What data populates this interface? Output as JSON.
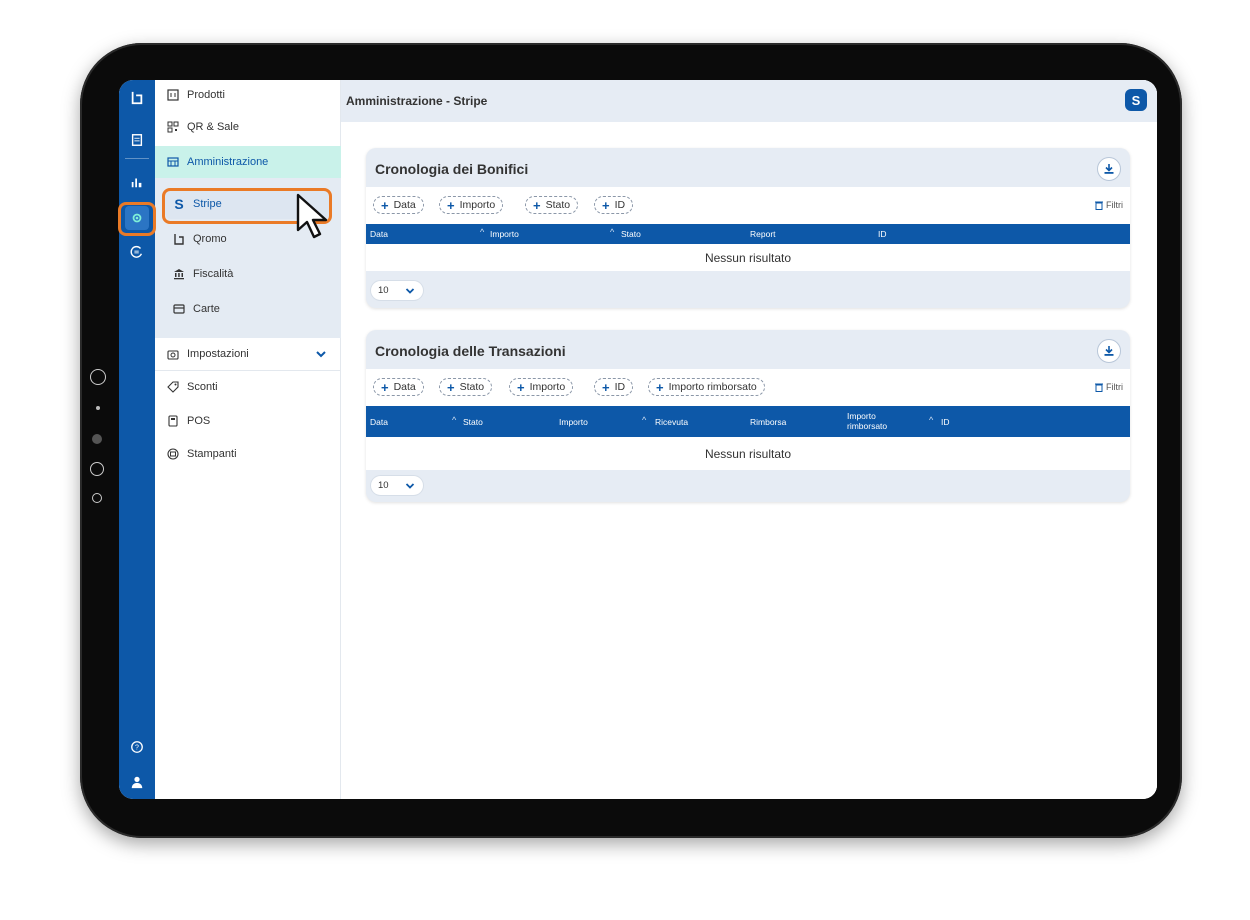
{
  "nav": {
    "items": [
      {
        "label": "Prodotti",
        "icon": "products-icon"
      },
      {
        "label": "QR & Sale",
        "icon": "qr-icon"
      },
      {
        "label": "Amministrazione",
        "icon": "admin-icon"
      }
    ],
    "sub_items": [
      {
        "label": "Stripe",
        "icon": "stripe-icon"
      },
      {
        "label": "Qromo",
        "icon": "qromo-icon"
      },
      {
        "label": "Fiscalità",
        "icon": "bank-icon"
      },
      {
        "label": "Carte",
        "icon": "card-icon"
      }
    ],
    "bottom_items": [
      {
        "label": "Impostazioni",
        "icon": "settings-icon"
      },
      {
        "label": "Sconti",
        "icon": "tag-icon"
      },
      {
        "label": "POS",
        "icon": "pos-icon"
      },
      {
        "label": "Stampanti",
        "icon": "printer-icon"
      }
    ]
  },
  "header": {
    "title": "Amministrazione - Stripe",
    "badge": "S"
  },
  "bonifici": {
    "title": "Cronologia dei Bonifici",
    "filters": [
      "Data",
      "Importo",
      "Stato",
      "ID"
    ],
    "filtri_label": "Filtri",
    "columns": [
      "Data",
      "Importo",
      "Stato",
      "Report",
      "ID"
    ],
    "empty": "Nessun risultato",
    "page_size": "10"
  },
  "transazioni": {
    "title": "Cronologia delle Transazioni",
    "filters": [
      "Data",
      "Stato",
      "Importo",
      "ID",
      "Importo rimborsato"
    ],
    "filtri_label": "Filtri",
    "columns": [
      "Data",
      "Stato",
      "Importo",
      "Ricevuta",
      "Rimborsa",
      "Importo rimborsato",
      "ID"
    ],
    "empty": "Nessun risultato",
    "page_size": "10"
  },
  "colors": {
    "primary": "#0d58a8",
    "highlight": "#ea7a26",
    "active_nav": "#c9f2ea"
  }
}
